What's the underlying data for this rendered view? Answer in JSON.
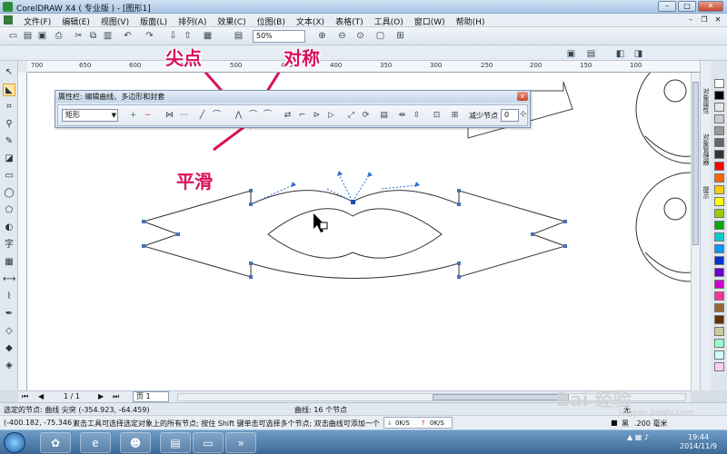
{
  "window": {
    "title": "CorelDRAW X4 ( 专业版 ) - [图形1]",
    "buttons": [
      "–",
      "□",
      "✕"
    ]
  },
  "menubar": {
    "items": [
      "文件(F)",
      "编辑(E)",
      "视图(V)",
      "版面(L)",
      "排列(A)",
      "效果(C)",
      "位图(B)",
      "文本(X)",
      "表格(T)",
      "工具(O)",
      "窗口(W)",
      "帮助(H)"
    ]
  },
  "toolbar": {
    "zoom": "50%"
  },
  "ruler": {
    "ticks": [
      "700",
      "650",
      "600",
      "550",
      "500",
      "450",
      "400",
      "350",
      "300",
      "250",
      "200",
      "150",
      "100"
    ]
  },
  "property_dialog": {
    "title": "属性栏: 编辑曲线、多边形和封套",
    "close": "x",
    "shape_select": "矩形",
    "reduce_nodes_label": "减少节点",
    "reduce_nodes_value": "0"
  },
  "annotations": {
    "cusp": "尖点",
    "symmetric": "对称",
    "smooth": "平滑"
  },
  "docker_tabs": [
    "对象属性",
    "对象管理器",
    "提示"
  ],
  "page_nav": {
    "first": "⏮",
    "prev": "◀",
    "counter": "1 / 1",
    "next": "▶",
    "last": "⏭",
    "page_tab": "页 1"
  },
  "status": {
    "selected_nodes": "选定的节点: 曲线 尖突 (-354.923, -64.459)",
    "curve_info": "曲线: 16 个节点",
    "cursor_coords": "(-400.182, -75.346 )",
    "hint": "双击工具可选择选定对象上的所有节点; 按住 Shift 键单击可选择多个节点; 双击曲线可添加一个节点;",
    "net_down": "0K/S",
    "net_up": "0K/S",
    "fill_label": "黑",
    "outline_label": ".200 毫米",
    "none_label": "无"
  },
  "taskbar": {
    "time": "19:44",
    "date": "2014/11/9"
  },
  "watermark": {
    "main": "Bai 经验",
    "sub": "jingyan.baidu.com"
  },
  "palette": [
    "#ffffff",
    "#000000",
    "#e6e6e6",
    "#cccccc",
    "#999999",
    "#666666",
    "#333333",
    "#ff0000",
    "#ff6600",
    "#ffcc00",
    "#ffff00",
    "#99cc00",
    "#00aa00",
    "#00cccc",
    "#0099ff",
    "#0033cc",
    "#6600cc",
    "#cc00cc",
    "#ff3399",
    "#996633",
    "#663300",
    "#cccc99",
    "#99ffcc",
    "#ccffff",
    "#ffccff"
  ]
}
